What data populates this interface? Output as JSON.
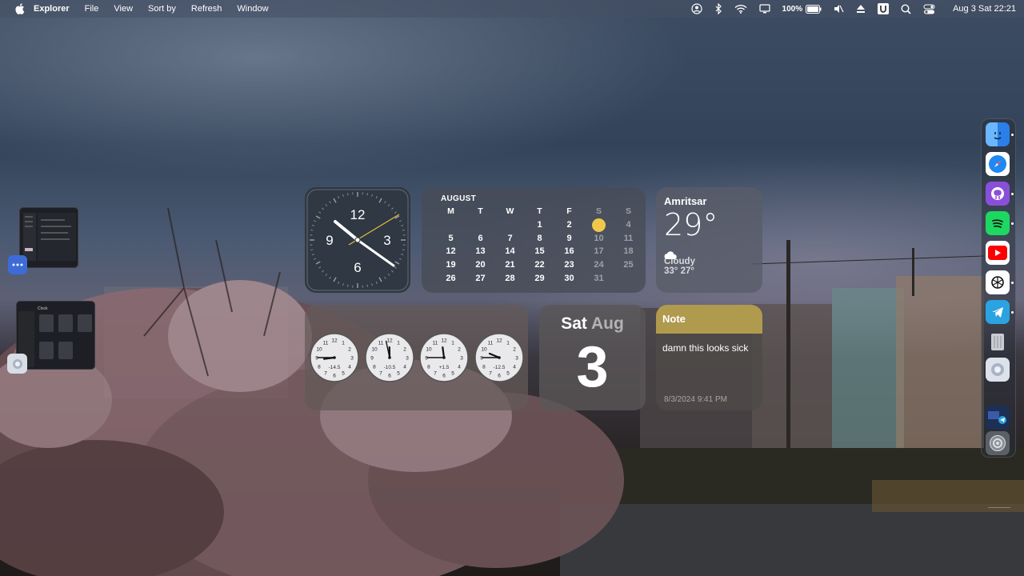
{
  "menubar": {
    "app_name": "Explorer",
    "menus": [
      "File",
      "View",
      "Sort by",
      "Refresh",
      "Window"
    ],
    "battery": "100%",
    "datetime": "Aug 3 Sat 22:21",
    "icons": [
      "apple-icon",
      "user-icon",
      "bluetooth-icon",
      "wifi-icon",
      "display-icon",
      "battery-icon",
      "mute-icon",
      "eject-icon",
      "u-icon",
      "search-icon",
      "control-center-icon"
    ]
  },
  "clock_widget": {
    "numerals": [
      "12",
      "3",
      "6",
      "9"
    ],
    "time": "22:21"
  },
  "calendar_widget": {
    "month": "AUGUST",
    "weekdays": [
      "M",
      "T",
      "W",
      "T",
      "F",
      "S",
      "S"
    ],
    "weeks": [
      [
        "",
        "",
        "",
        "1",
        "2",
        "3",
        "4"
      ],
      [
        "5",
        "6",
        "7",
        "8",
        "9",
        "10",
        "11"
      ],
      [
        "12",
        "13",
        "14",
        "15",
        "16",
        "17",
        "18"
      ],
      [
        "19",
        "20",
        "21",
        "22",
        "23",
        "24",
        "25"
      ],
      [
        "26",
        "27",
        "28",
        "29",
        "30",
        "31",
        ""
      ]
    ],
    "today": "3",
    "today_color": "#f0c74a"
  },
  "weather_widget": {
    "city": "Amritsar",
    "temperature": "29°",
    "condition": "Cloudy",
    "high_low": "33° 27°"
  },
  "world_clock_widget": {
    "clocks": [
      {
        "offset": "-14.5",
        "time": "8:45"
      },
      {
        "offset": "-10.5",
        "time": "11:58"
      },
      {
        "offset": "+1.5",
        "time": "11:45"
      },
      {
        "offset": "-12.5",
        "time": "9:45"
      }
    ]
  },
  "date_widget": {
    "weekday": "Sat",
    "month": "Aug",
    "day": "3"
  },
  "note_widget": {
    "title": "Note",
    "body": "damn this looks sick",
    "timestamp": "8/3/2024 9:41 PM"
  },
  "dock": {
    "apps": [
      "finder-icon",
      "safari-icon",
      "github-icon",
      "spotify-icon",
      "youtube-icon",
      "chatgpt-icon",
      "telegram-icon",
      "trash-icon",
      "system-icon",
      "mail-icon",
      "settings-icon"
    ]
  },
  "desktop_thumbs": {
    "window_title": "Clock"
  }
}
